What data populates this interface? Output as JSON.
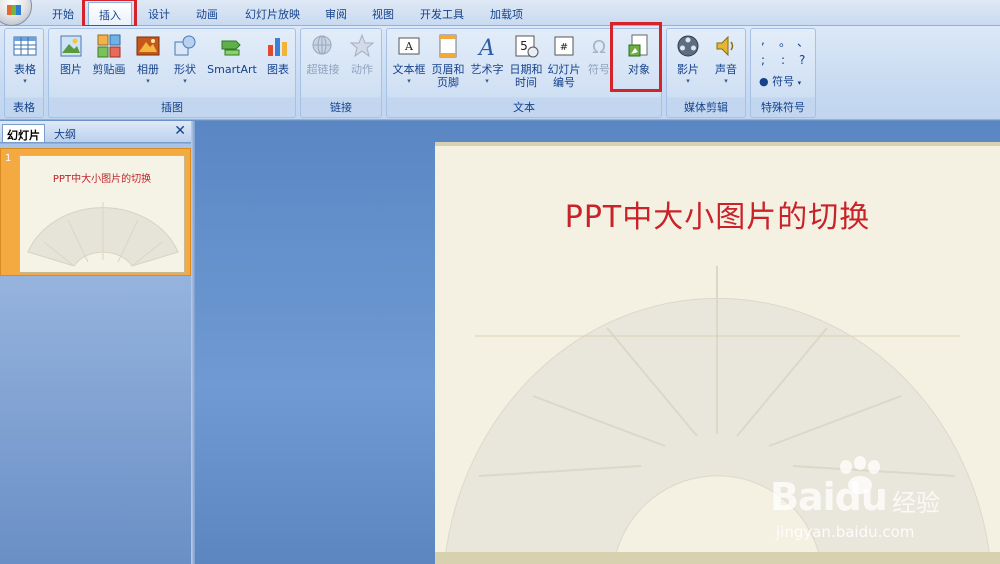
{
  "ribbon_tabs": [
    "开始",
    "插入",
    "设计",
    "动画",
    "幻灯片放映",
    "审阅",
    "视图",
    "开发工具",
    "加载项"
  ],
  "groups": {
    "table": {
      "label": "表格",
      "buttons": [
        "表格"
      ]
    },
    "illustrations": {
      "label": "插图",
      "buttons": [
        "图片",
        "剪贴画",
        "相册",
        "形状",
        "SmartArt",
        "图表"
      ]
    },
    "links": {
      "label": "链接",
      "buttons": [
        "超链接",
        "动作"
      ]
    },
    "text": {
      "label": "文本",
      "buttons": [
        {
          "l1": "文本框",
          "l2": ""
        },
        {
          "l1": "页眉和",
          "l2": "页脚"
        },
        {
          "l1": "艺术字",
          "l2": ""
        },
        {
          "l1": "日期和",
          "l2": "时间"
        },
        {
          "l1": "幻灯片",
          "l2": "编号"
        },
        {
          "l1": "符号",
          "l2": ""
        },
        {
          "l1": "对象",
          "l2": ""
        }
      ]
    },
    "media": {
      "label": "媒体剪辑",
      "buttons": [
        "影片",
        "声音"
      ]
    },
    "special": {
      "label": "特殊符号",
      "symbols": [
        ",",
        "。",
        "、",
        ";",
        ":",
        "?"
      ],
      "button": "符号"
    }
  },
  "panel": {
    "tab_slides": "幻灯片",
    "tab_outline": "大纲",
    "close": "✕",
    "slide_number": "1"
  },
  "slide": {
    "title": "PPT中大小图片的切换"
  },
  "watermark": {
    "brand": "Bai",
    "brand_tail": "du",
    "cn": "经验",
    "url": "jingyan.baidu.com"
  },
  "colors": {
    "title_red": "#c9232a",
    "highlight_red": "#d5232b"
  }
}
